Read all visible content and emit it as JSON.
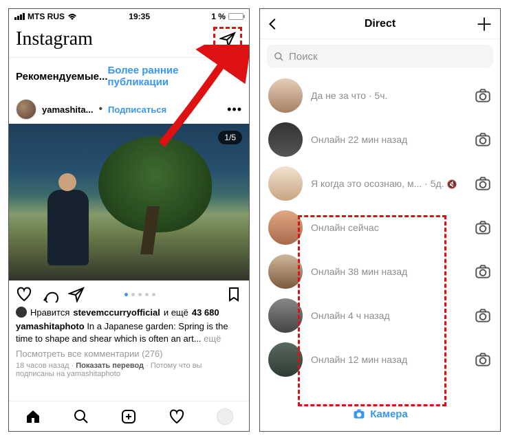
{
  "status": {
    "carrier": "MTS RUS",
    "time": "19:35",
    "battery": "1 %"
  },
  "feed": {
    "logo": "Instagram",
    "recommended_label": "Рекомендуемые...",
    "earlier_link": "Более ранние публикации",
    "post": {
      "username": "yamashita...",
      "follow": "Подписаться",
      "sep": "•",
      "pager": "1/5",
      "likes_prefix": "Нравится",
      "likes_user": "stevemccurryofficial",
      "likes_and": "и ещё",
      "likes_count": "43 680",
      "caption_user": "yamashitaphoto",
      "caption_text": "In a Japanese garden: Spring is the time to shape and shear which is often an art...",
      "caption_more": "ещё",
      "view_comments": "Посмотреть все комментарии  (276)",
      "time_ago": "18 часов назад",
      "translate": "Показать перевод",
      "reason": "Потому что вы подписаны на yamashitaphoto"
    }
  },
  "direct": {
    "title": "Direct",
    "search_placeholder": "Поиск",
    "camera_label": "Камера",
    "threads": [
      {
        "msg": "Да не за что",
        "time": "5ч."
      },
      {
        "msg": "Онлайн 22 мин назад",
        "time": ""
      },
      {
        "msg": "Я когда это осознаю, м...",
        "time": "5д.",
        "muted": true
      },
      {
        "msg": "Онлайн сейчас",
        "time": ""
      },
      {
        "msg": "Онлайн 38 мин назад",
        "time": ""
      },
      {
        "msg": "Онлайн 4 ч назад",
        "time": ""
      },
      {
        "msg": "Онлайн 12 мин назад",
        "time": ""
      }
    ]
  }
}
